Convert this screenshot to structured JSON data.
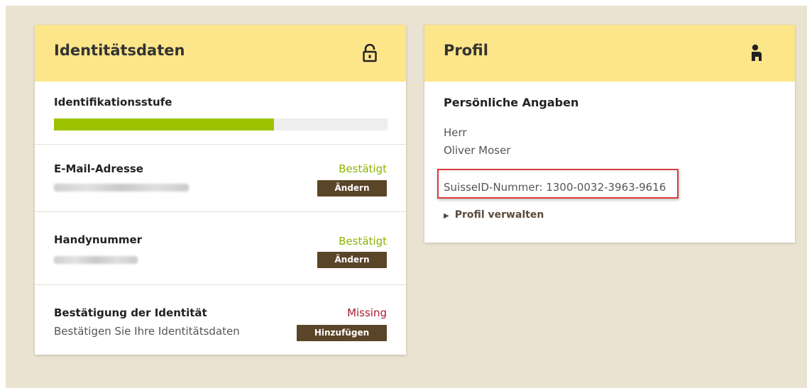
{
  "identity_card": {
    "title": "Identitätsdaten",
    "icon": "unlocked-lock-icon",
    "level": {
      "label": "Identifikationsstufe",
      "progress": 0.66
    },
    "email": {
      "label": "E-Mail-Adresse",
      "status": "Bestätigt",
      "button": "Ändern"
    },
    "phone": {
      "label": "Handynummer",
      "status": "Bestätigt",
      "button": "Ändern"
    },
    "confirm": {
      "label": "Bestätigung der Identität",
      "status": "Missing",
      "description": "Bestätigen Sie Ihre Identitätsdaten",
      "button": "Hinzufügen"
    }
  },
  "profile_card": {
    "title": "Profil",
    "icon": "person-icon",
    "section_title": "Persönliche Angaben",
    "salutation": "Herr",
    "name": "Oliver Moser",
    "suisse_id": "SuisseID-Nummer: 1300-0032-3963-9616",
    "manage_link": "Profil verwalten"
  },
  "colors": {
    "header_bg": "#fde58a",
    "page_bg": "#ebe3d2",
    "progress_fill": "#9cc300",
    "confirmed": "#8cb400",
    "missing": "#a51c30",
    "button_bg": "#5b4528",
    "highlight_border": "#d93b3b"
  }
}
